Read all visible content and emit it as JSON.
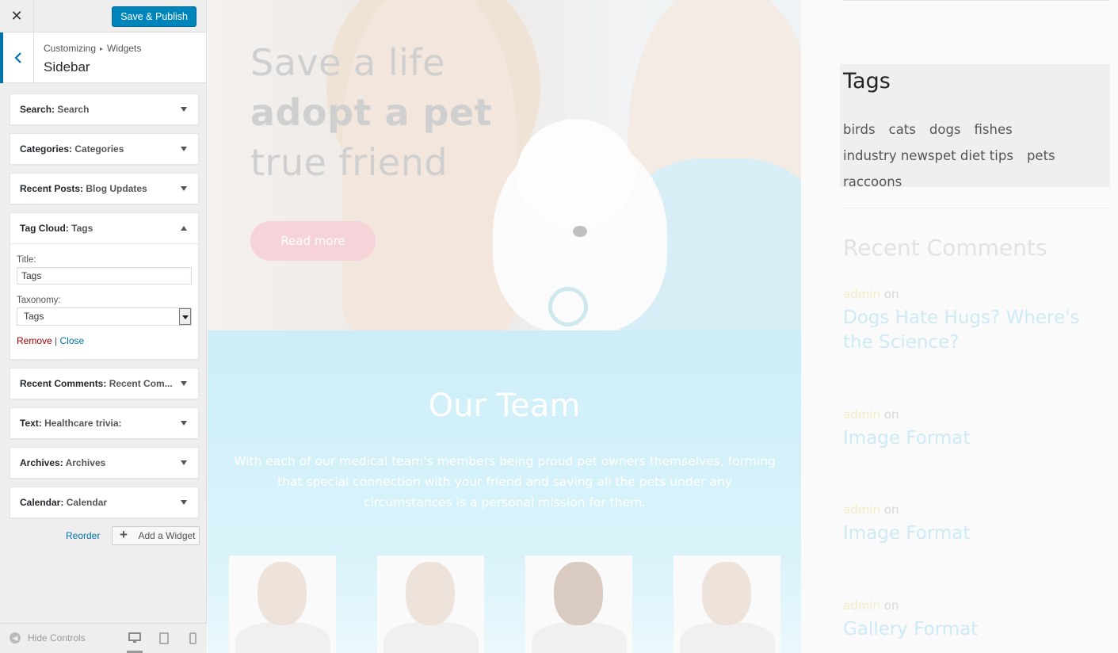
{
  "panel": {
    "close_icon": "close-icon",
    "publish_label": "Save & Publish",
    "breadcrumb_root": "Customizing",
    "breadcrumb_parent": "Widgets",
    "section_title": "Sidebar",
    "widgets": [
      {
        "type": "Search",
        "title": "Search"
      },
      {
        "type": "Categories",
        "title": "Categories"
      },
      {
        "type": "Recent Posts",
        "title": "Blog Updates"
      },
      {
        "type": "Tag Cloud",
        "title": "Tags"
      },
      {
        "type": "Recent Comments",
        "title": "Recent Com..."
      },
      {
        "type": "Text",
        "title": "Healthcare trivia:"
      },
      {
        "type": "Archives",
        "title": "Archives"
      },
      {
        "type": "Calendar",
        "title": "Calendar"
      }
    ],
    "tag_cloud_form": {
      "title_label": "Title:",
      "title_value": "Tags",
      "taxonomy_label": "Taxonomy:",
      "taxonomy_value": "Tags",
      "remove_label": "Remove",
      "separator": "|",
      "close_label": "Close"
    },
    "reorder_label": "Reorder",
    "add_widget_label": "Add a Widget",
    "hide_controls_label": "Hide Controls"
  },
  "preview": {
    "hero": {
      "line1": "Save a life",
      "line2": "adopt a pet",
      "line3": "true friend",
      "button": "Read more"
    },
    "team": {
      "title": "Our Team",
      "text": "With each of our medical team's members being proud pet owners themselves, forming that special connection with your friend and saving all the pets under any circumstances is a personal mission for them."
    },
    "sidebar": {
      "tags_title": "Tags",
      "tags": [
        "birds",
        "cats",
        "dogs",
        "fishes",
        "industry news",
        "pet diet tips",
        "pets",
        "raccoons"
      ],
      "recent_comments_title": "Recent Comments",
      "comments": [
        {
          "author": "admin",
          "on": "on",
          "post": "Dogs Hate Hugs? Where's the Science?"
        },
        {
          "author": "admin",
          "on": "on",
          "post": "Image Format"
        },
        {
          "author": "admin",
          "on": "on",
          "post": "Image Format"
        },
        {
          "author": "admin",
          "on": "on",
          "post": "Gallery Format"
        }
      ]
    }
  },
  "colors": {
    "accent": "#0073aa",
    "publish": "#0085ba",
    "remove": "#aa0000"
  }
}
